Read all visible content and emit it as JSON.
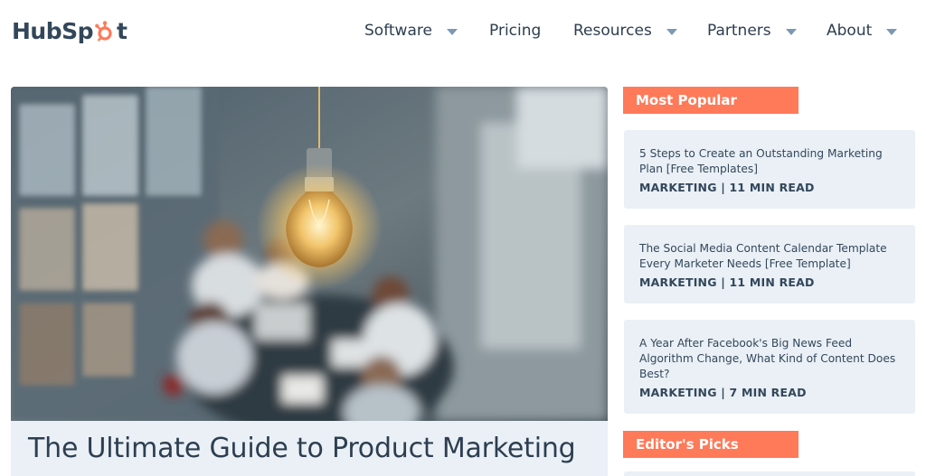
{
  "brand": {
    "name_part1": "Hub",
    "name_part2": "Sp",
    "name_part3": "t"
  },
  "nav": {
    "items": [
      {
        "label": "Software",
        "has_dropdown": true
      },
      {
        "label": "Pricing",
        "has_dropdown": false
      },
      {
        "label": "Resources",
        "has_dropdown": true
      },
      {
        "label": "Partners",
        "has_dropdown": true
      },
      {
        "label": "About",
        "has_dropdown": true
      }
    ]
  },
  "hero": {
    "title": "The Ultimate Guide to Product Marketing",
    "image": "light-bulb-over-meeting-table"
  },
  "sidebar": {
    "most_popular_label": "Most Popular",
    "editors_picks_label": "Editor's Picks",
    "articles": [
      {
        "title": "5 Steps to Create an Outstanding Marketing Plan [Free Templates]",
        "meta": "MARKETING | 11 MIN READ"
      },
      {
        "title": "The Social Media Content Calendar Template Every Marketer Needs [Free Template]",
        "meta": "MARKETING | 11 MIN READ"
      },
      {
        "title": "A Year After Facebook's Big News Feed Algorithm Change, What Kind of Content Does Best?",
        "meta": "MARKETING | 7 MIN READ"
      }
    ]
  },
  "colors": {
    "accent": "#ff7a59",
    "text": "#33475b",
    "card_bg": "#eaf0f6",
    "caret": "#7c98b6"
  }
}
